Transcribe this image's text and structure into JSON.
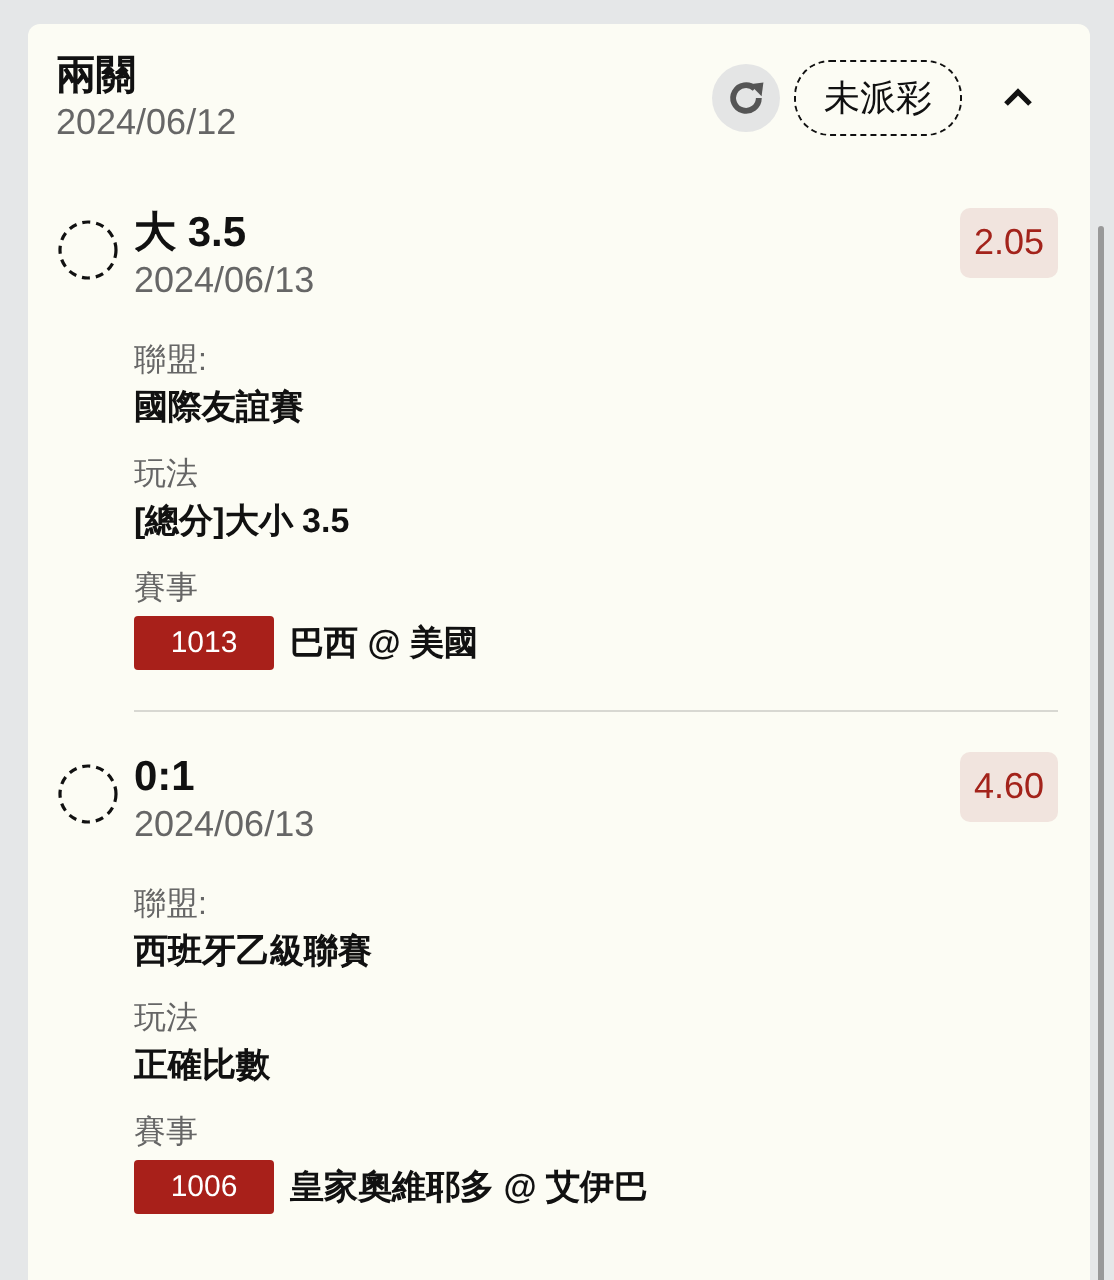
{
  "card": {
    "title": "兩關",
    "date": "2024/06/12",
    "status": "未派彩",
    "expanded": true
  },
  "legs": [
    {
      "selection": "大 3.5",
      "date": "2024/06/13",
      "odds": "2.05",
      "fields": [
        {
          "kind": "text",
          "label": "聯盟:",
          "value": "國際友誼賽"
        },
        {
          "kind": "text",
          "label": "玩法",
          "value": "[總分]大小 3.5"
        },
        {
          "kind": "event",
          "label": "賽事",
          "code": "1013",
          "value": "巴西 @ 美國"
        }
      ]
    },
    {
      "selection": "0:1",
      "date": "2024/06/13",
      "odds": "4.60",
      "fields": [
        {
          "kind": "text",
          "label": "聯盟:",
          "value": "西班牙乙級聯賽"
        },
        {
          "kind": "text",
          "label": "玩法",
          "value": "正確比數"
        },
        {
          "kind": "event",
          "label": "賽事",
          "code": "1006",
          "value": "皇家奧維耶多 @ 艾伊巴"
        }
      ]
    }
  ]
}
